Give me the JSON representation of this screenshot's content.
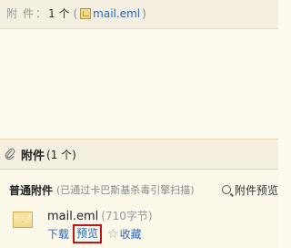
{
  "header": {
    "attach_label": "附件",
    "attach_colon": "：",
    "attach_count": "1 个",
    "paren_open": "(",
    "filename": "mail.eml",
    "paren_close": ")"
  },
  "attachments": {
    "title": "附件",
    "count": "(1 个)",
    "normal_title": "普通附件",
    "normal_note": "(已通过卡巴斯基杀毒引擎扫描)",
    "preview_all": "附件预览",
    "items": [
      {
        "name": "mail.eml",
        "size": "(710字节)",
        "download": "下载",
        "preview": "预览",
        "favorite": "收藏"
      }
    ]
  },
  "icons": {
    "clip": "paperclip-icon",
    "search": "search-icon",
    "file": "eml-file-icon",
    "star": "star-icon"
  },
  "colors": {
    "link": "#2a67b4",
    "highlight": "#c0141b",
    "band": "#f4efe0"
  }
}
